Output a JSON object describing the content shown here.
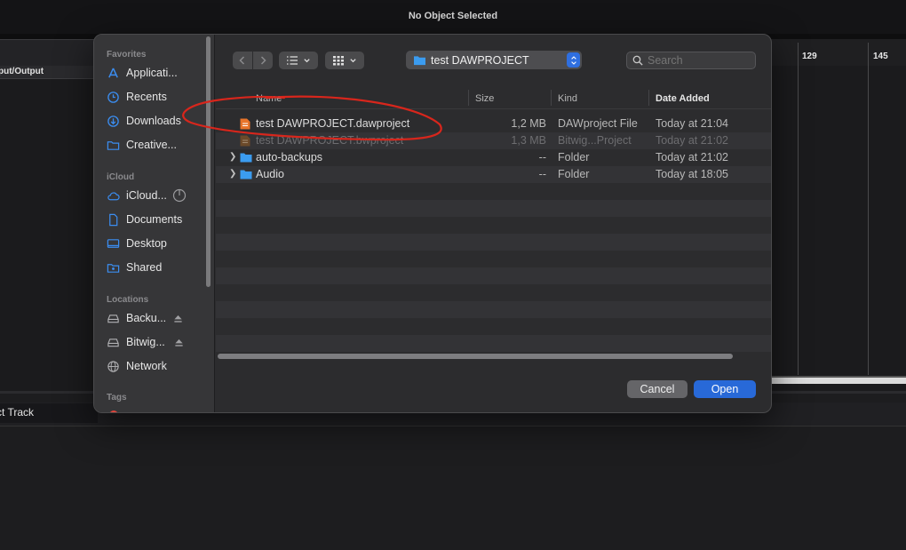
{
  "app": {
    "title": "No Object Selected",
    "io_header": "put/Output",
    "ruler": [
      "129",
      "145"
    ],
    "track_label": "ct Track"
  },
  "sidebar": {
    "favorites_title": "Favorites",
    "favorites": [
      {
        "label": "Applicati...",
        "icon": "applications-icon"
      },
      {
        "label": "Recents",
        "icon": "clock-icon"
      },
      {
        "label": "Downloads",
        "icon": "download-icon"
      },
      {
        "label": "Creative...",
        "icon": "folder-icon"
      }
    ],
    "icloud_title": "iCloud",
    "icloud": [
      {
        "label": "iCloud...",
        "icon": "cloud-icon"
      },
      {
        "label": "Documents",
        "icon": "document-icon"
      },
      {
        "label": "Desktop",
        "icon": "desktop-icon"
      },
      {
        "label": "Shared",
        "icon": "shared-folder-icon"
      }
    ],
    "locations_title": "Locations",
    "locations": [
      {
        "label": "Backu...",
        "icon": "drive-icon"
      },
      {
        "label": "Bitwig...",
        "icon": "drive-icon"
      },
      {
        "label": "Network",
        "icon": "globe-icon"
      }
    ],
    "tags_title": "Tags",
    "tag_color": "#e0453b"
  },
  "toolbar": {
    "location": "test DAWPROJECT",
    "search_placeholder": "Search"
  },
  "columns": {
    "name": "Name",
    "size": "Size",
    "kind": "Kind",
    "date": "Date Added"
  },
  "files": [
    {
      "name": "test DAWPROJECT.dawproject",
      "size": "1,2 MB",
      "kind": "DAWproject File",
      "date": "Today at 21:04",
      "type": "file",
      "dimmed": false
    },
    {
      "name": "test DAWPROJECT.bwproject",
      "size": "1,3 MB",
      "kind": "Bitwig...Project",
      "date": "Today at 21:02",
      "type": "file",
      "dimmed": true
    },
    {
      "name": "auto-backups",
      "size": "--",
      "kind": "Folder",
      "date": "Today at 21:02",
      "type": "folder",
      "dimmed": false
    },
    {
      "name": "Audio",
      "size": "--",
      "kind": "Folder",
      "date": "Today at 18:05",
      "type": "folder",
      "dimmed": false
    }
  ],
  "buttons": {
    "cancel": "Cancel",
    "open": "Open"
  },
  "colors": {
    "accent": "#2869d8",
    "folder": "#3b9cf0",
    "file_orange": "#e8742a",
    "annotation": "#d8261c"
  }
}
